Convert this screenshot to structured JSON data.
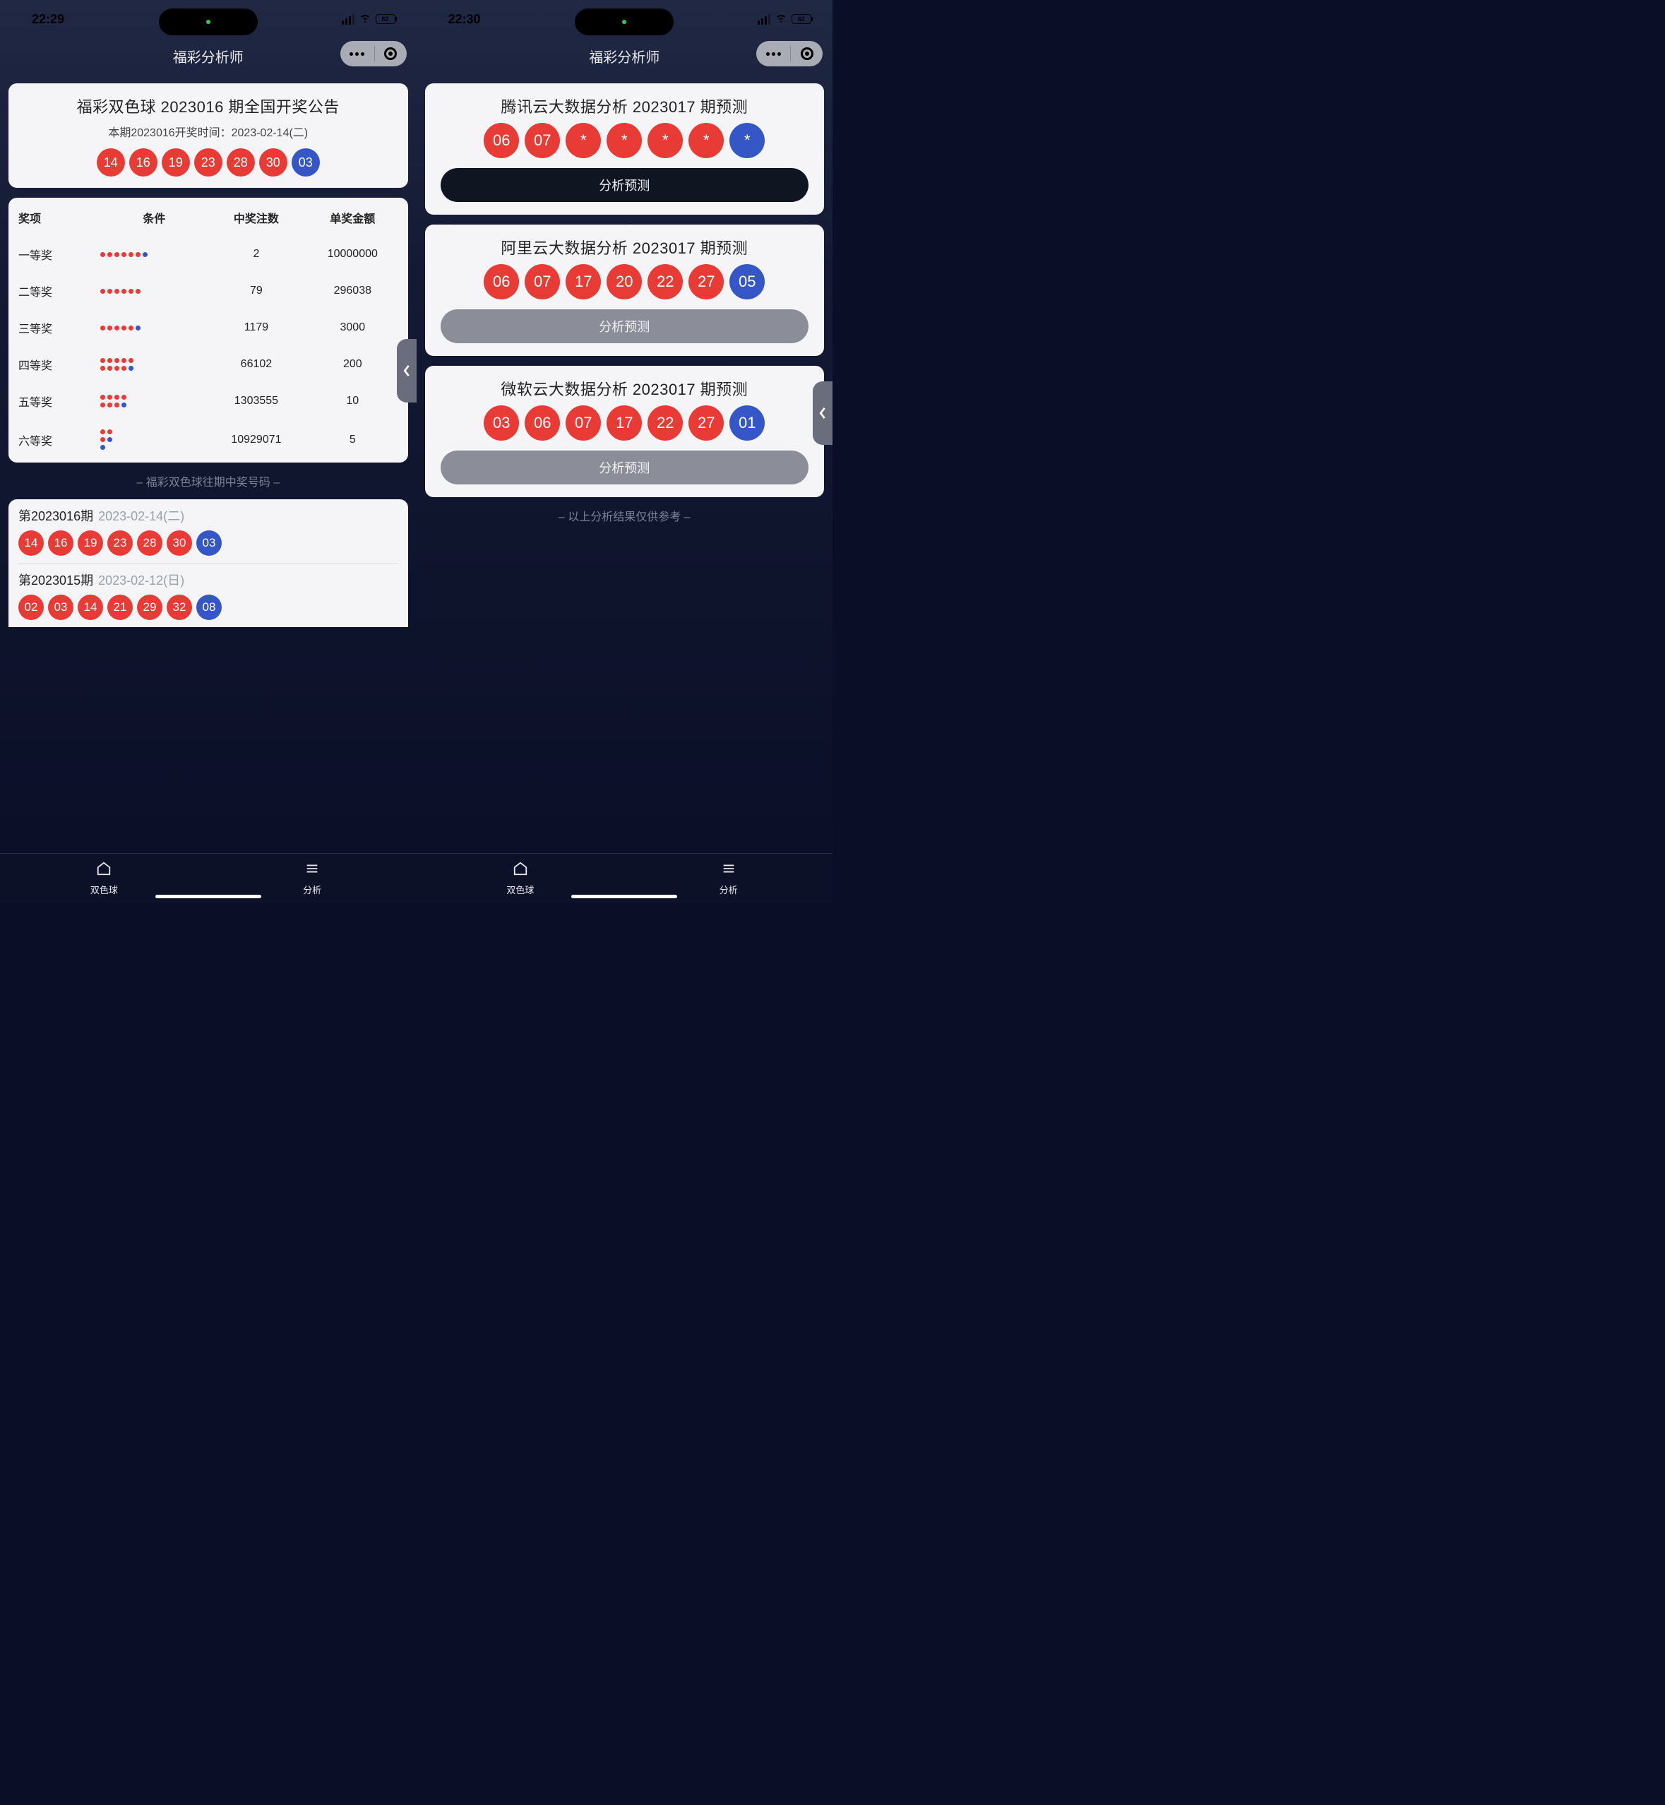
{
  "left": {
    "status_time": "22:29",
    "battery": "62",
    "nav_title": "福彩分析师",
    "announce": {
      "title": "福彩双色球 2023016 期全国开奖公告",
      "sub": "本期2023016开奖时间：2023-02-14(二)",
      "reds": [
        "14",
        "16",
        "19",
        "23",
        "28",
        "30"
      ],
      "blue": "03"
    },
    "prize_header": {
      "name": "奖项",
      "cond": "条件",
      "count": "中奖注数",
      "amount": "单奖金额"
    },
    "prizes": [
      {
        "name": "一等奖",
        "rows": [
          [
            1,
            1,
            1,
            1,
            1,
            1,
            2
          ]
        ],
        "count": "2",
        "amount": "10000000"
      },
      {
        "name": "二等奖",
        "rows": [
          [
            1,
            1,
            1,
            1,
            1,
            1
          ]
        ],
        "count": "79",
        "amount": "296038"
      },
      {
        "name": "三等奖",
        "rows": [
          [
            1,
            1,
            1,
            1,
            1,
            2
          ]
        ],
        "count": "1179",
        "amount": "3000"
      },
      {
        "name": "四等奖",
        "rows": [
          [
            1,
            1,
            1,
            1,
            1
          ],
          [
            1,
            1,
            1,
            1,
            2
          ]
        ],
        "count": "66102",
        "amount": "200"
      },
      {
        "name": "五等奖",
        "rows": [
          [
            1,
            1,
            1,
            1
          ],
          [
            1,
            1,
            1,
            2
          ]
        ],
        "count": "1303555",
        "amount": "10"
      },
      {
        "name": "六等奖",
        "rows": [
          [
            1,
            1
          ],
          [
            1,
            2
          ],
          [
            2
          ]
        ],
        "count": "10929071",
        "amount": "5"
      }
    ],
    "history_label": "– 福彩双色球往期中奖号码 –",
    "history": [
      {
        "period": "第2023016期",
        "date": "2023-02-14(二)",
        "reds": [
          "14",
          "16",
          "19",
          "23",
          "28",
          "30"
        ],
        "blue": "03"
      },
      {
        "period": "第2023015期",
        "date": "2023-02-12(日)",
        "reds": [
          "02",
          "03",
          "14",
          "21",
          "29",
          "32"
        ],
        "blue": "08"
      }
    ],
    "tabs": {
      "home": "双色球",
      "analysis": "分析"
    }
  },
  "right": {
    "status_time": "22:30",
    "battery": "62",
    "nav_title": "福彩分析师",
    "predictions": [
      {
        "title": "腾讯云大数据分析 2023017 期预测",
        "reds": [
          "06",
          "07",
          "*",
          "*",
          "*",
          "*"
        ],
        "blue": "*",
        "btn": "分析预测",
        "btn_style": "dark"
      },
      {
        "title": "阿里云大数据分析 2023017 期预测",
        "reds": [
          "06",
          "07",
          "17",
          "20",
          "22",
          "27"
        ],
        "blue": "05",
        "btn": "分析预测",
        "btn_style": "grey"
      },
      {
        "title": "微软云大数据分析 2023017 期预测",
        "reds": [
          "03",
          "06",
          "07",
          "17",
          "22",
          "27"
        ],
        "blue": "01",
        "btn": "分析预测",
        "btn_style": "grey"
      }
    ],
    "disclaimer": "– 以上分析结果仅供参考 –",
    "tabs": {
      "home": "双色球",
      "analysis": "分析"
    }
  }
}
